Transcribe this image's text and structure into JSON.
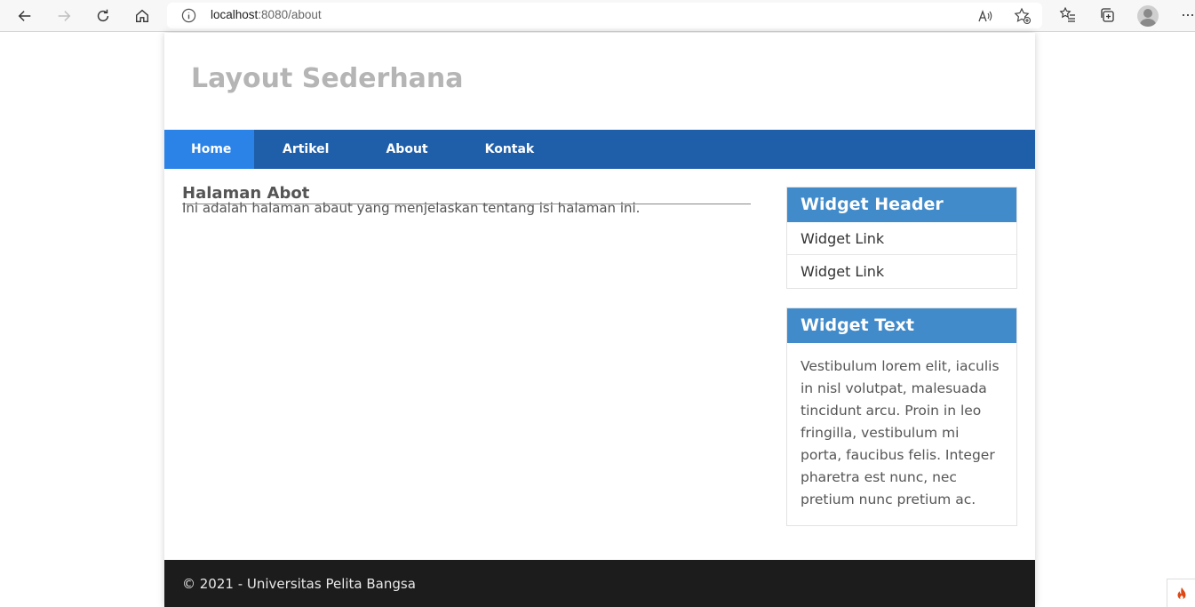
{
  "browser": {
    "url_host": "localhost",
    "url_path": ":8080/about"
  },
  "site": {
    "title": "Layout Sederhana"
  },
  "nav": {
    "items": [
      {
        "label": "Home"
      },
      {
        "label": "Artikel"
      },
      {
        "label": "About"
      },
      {
        "label": "Kontak"
      }
    ],
    "active": "Home"
  },
  "main": {
    "heading": "Halaman Abot",
    "body": "Ini adalah halaman abaut yang menjelaskan tentang isi halaman ini."
  },
  "sidebar": {
    "widget1": {
      "title": "Widget Header",
      "links": [
        {
          "label": "Widget Link"
        },
        {
          "label": "Widget Link"
        }
      ]
    },
    "widget2": {
      "title": "Widget Text",
      "text": "Vestibulum lorem elit, iaculis in nisl volutpat, malesuada tincidunt arcu. Proin in leo fringilla, vestibulum mi porta, faucibus felis. Integer pharetra est nunc, nec pretium nunc pretium ac."
    }
  },
  "footer": {
    "text": "© 2021 - Universitas Pelita Bangsa"
  },
  "colors": {
    "nav_bg": "#1f5faa",
    "nav_active": "#2b83e8",
    "widget_header": "#428bca",
    "footer_bg": "#1c1c1c"
  }
}
